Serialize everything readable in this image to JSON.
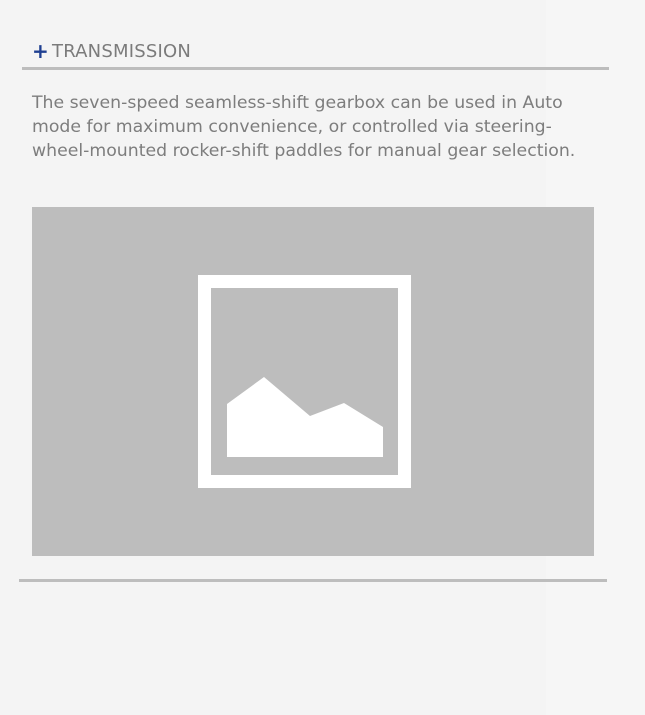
{
  "section": {
    "toggle_icon": "plus-icon",
    "title": "TRANSMISSION",
    "description": "The seven-speed seamless-shift gearbox can be used in Auto mode for maximum convenience, or controlled via steering-wheel-mounted rocker-shift paddles for manual gear selection.",
    "image_icon": "image-placeholder-icon"
  },
  "colors": {
    "accent": "#1f3f91",
    "text": "#7d7d7d",
    "divider": "#bdbdbd",
    "placeholder": "#bdbdbd",
    "background": "#f4f4f4"
  }
}
